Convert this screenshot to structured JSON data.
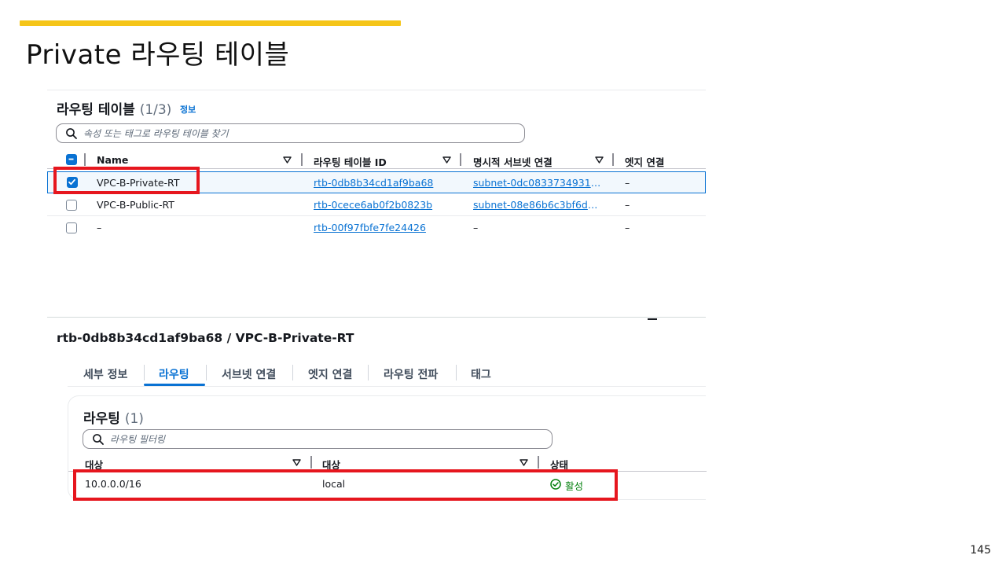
{
  "slide": {
    "title": "Private 라우팅 테이블",
    "page_number": "145",
    "accent_color": "#f5c518",
    "highlight_color": "#e6161e"
  },
  "route_tables_panel": {
    "heading": "라우팅 테이블",
    "count": "(1/3)",
    "info_label": "정보",
    "search_placeholder": "속성 또는 태그로 라우팅 테이블 찾기",
    "columns": [
      "Name",
      "라우팅 테이블 ID",
      "명시적 서브넷 연결",
      "엣지 연결"
    ],
    "rows": [
      {
        "selected": true,
        "name": "VPC-B-Private-RT",
        "id": "rtb-0db8b34cd1af9ba68",
        "subnet": "subnet-0dc08337349316…",
        "edge": "–"
      },
      {
        "selected": false,
        "name": "VPC-B-Public-RT",
        "id": "rtb-0cece6ab0f2b0823b",
        "subnet": "subnet-08e86b6c3bf6d0…",
        "edge": "–"
      },
      {
        "selected": false,
        "name": "–",
        "id": "rtb-00f97fbfe7fe24426",
        "subnet": "–",
        "edge": "–"
      }
    ]
  },
  "detail": {
    "title": "rtb-0db8b34cd1af9ba68 / VPC-B-Private-RT",
    "tabs": [
      "세부 정보",
      "라우팅",
      "서브넷 연결",
      "엣지 연결",
      "라우팅 전파",
      "태그"
    ],
    "active_tab": "라우팅"
  },
  "routes_panel": {
    "heading": "라우팅",
    "count": "(1)",
    "search_placeholder": "라우팅 필터링",
    "columns": [
      "대상",
      "대상",
      "상태"
    ],
    "rows": [
      {
        "destination": "10.0.0.0/16",
        "target": "local",
        "status": "활성"
      }
    ]
  }
}
